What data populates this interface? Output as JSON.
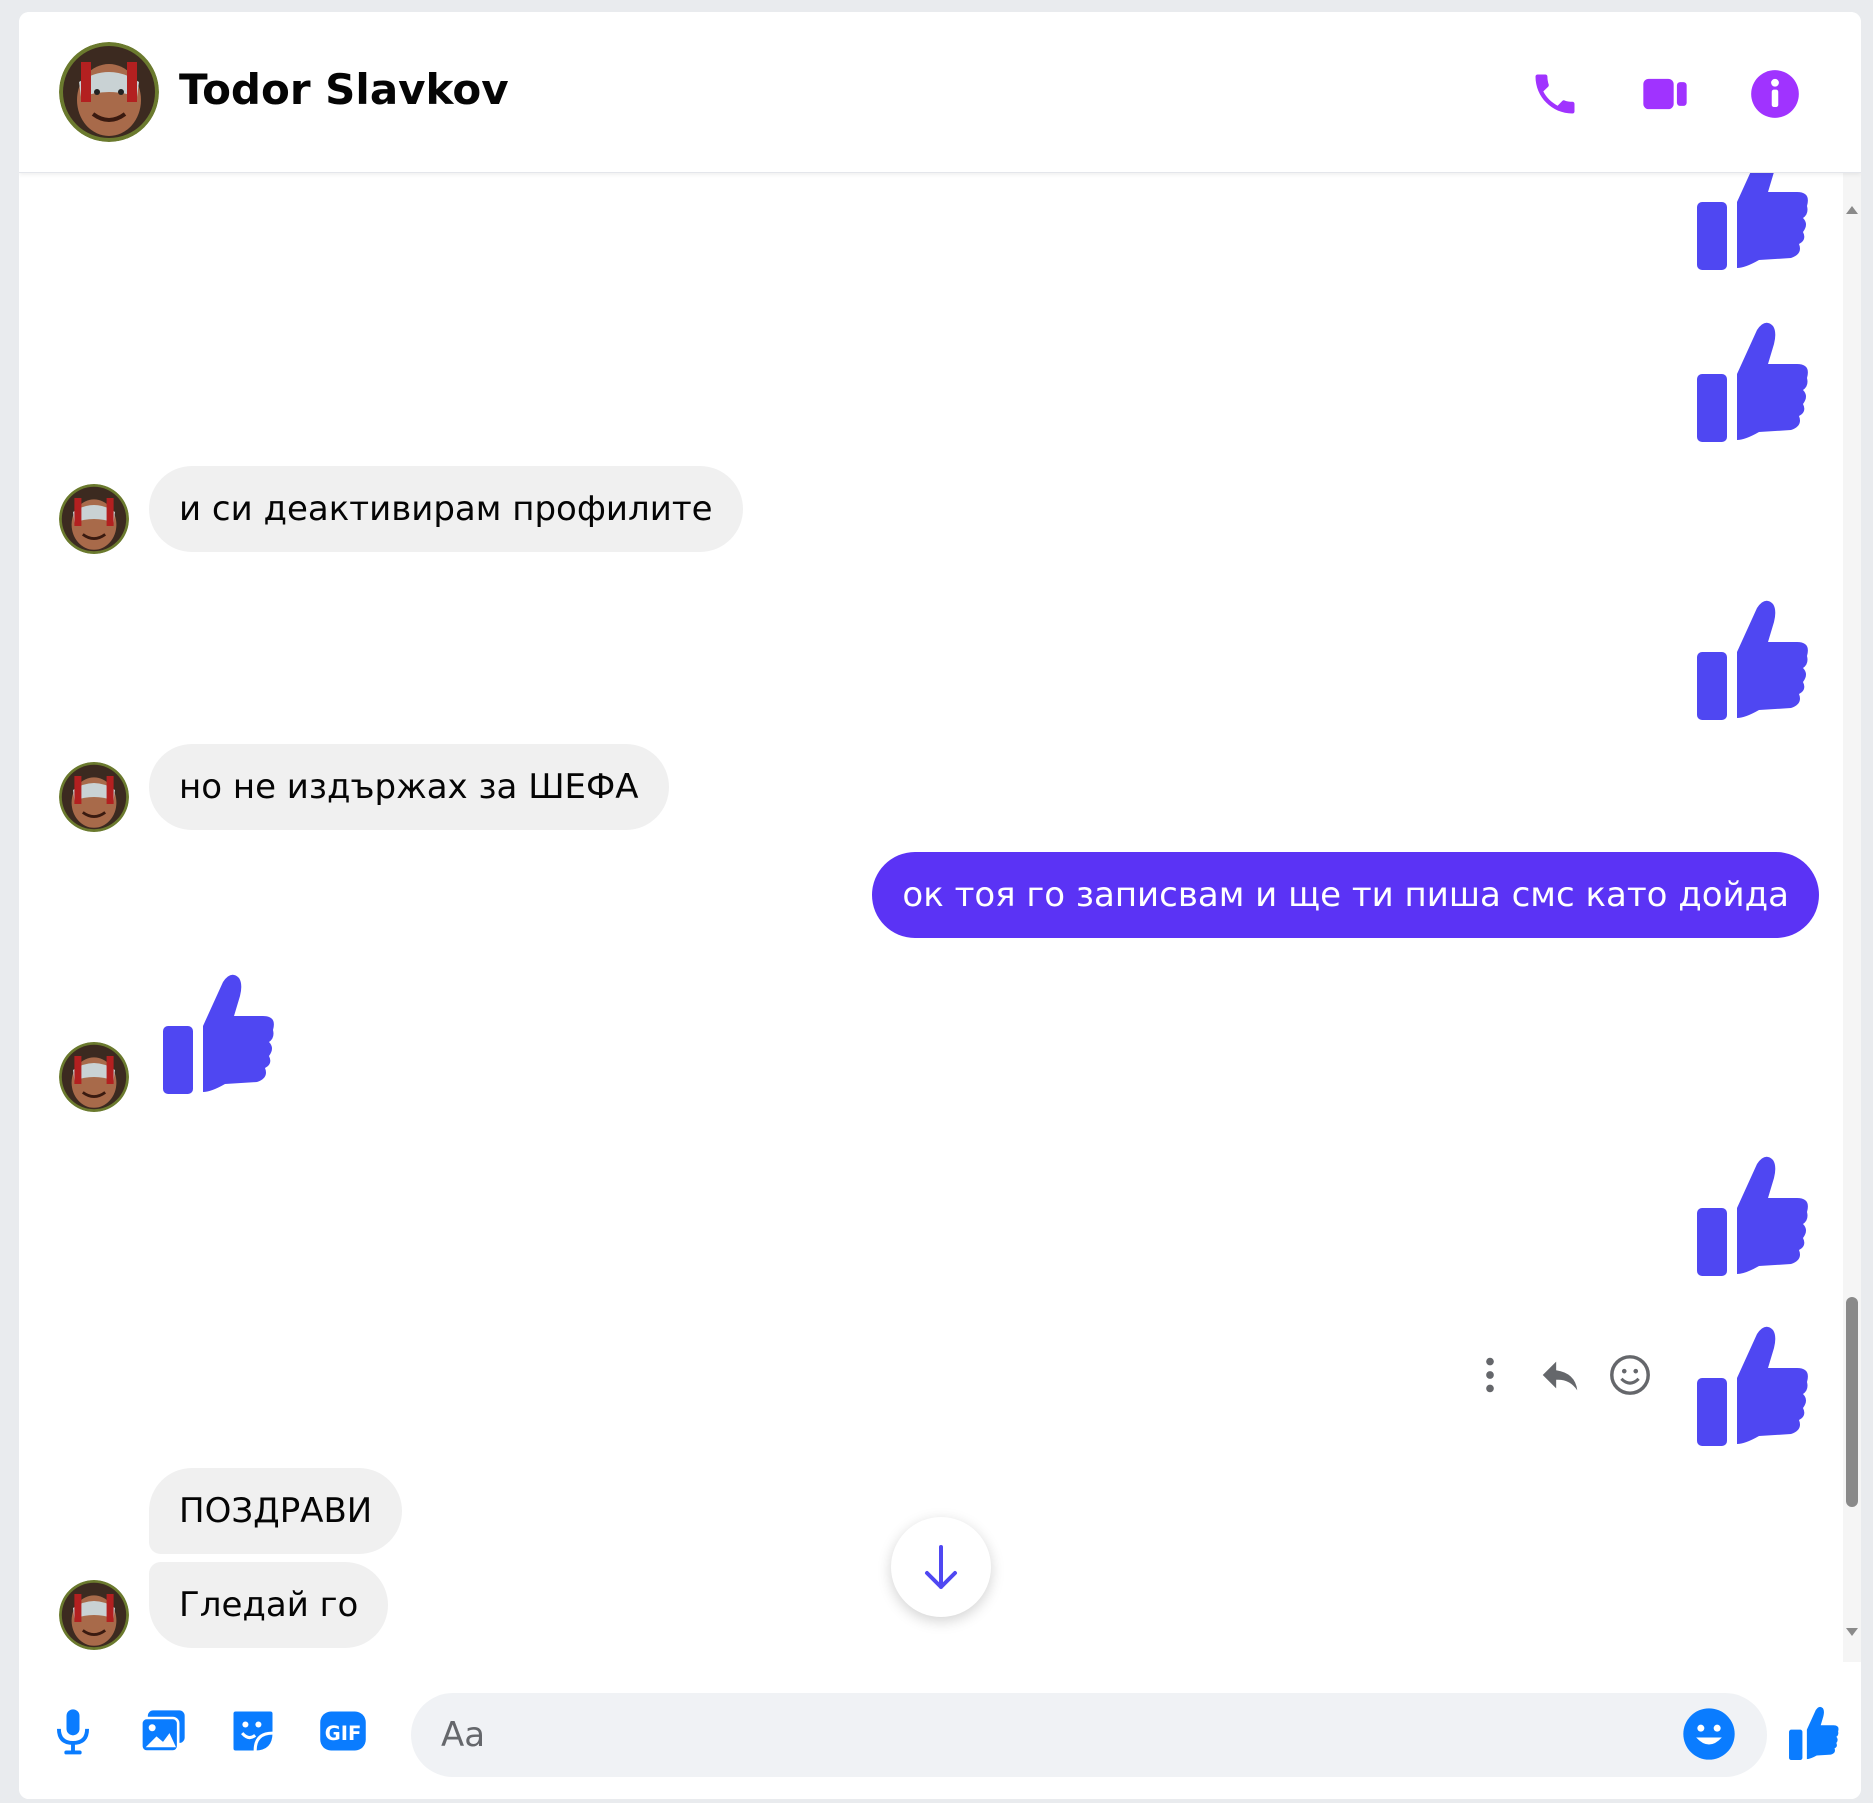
{
  "header": {
    "contact_name": "Todor Slavkov",
    "icons": [
      "phone-icon",
      "video-icon",
      "info-icon"
    ],
    "accent_color": "#a033ff"
  },
  "messages": [
    {
      "id": "m1",
      "direction": "out",
      "type": "like"
    },
    {
      "id": "m2",
      "direction": "out",
      "type": "like"
    },
    {
      "id": "m3",
      "direction": "in",
      "type": "text",
      "text": "и си деактивирам профилите"
    },
    {
      "id": "m4",
      "direction": "out",
      "type": "like"
    },
    {
      "id": "m5",
      "direction": "in",
      "type": "text",
      "text": "но не издържах за ШЕФА"
    },
    {
      "id": "m6",
      "direction": "out",
      "type": "text",
      "text": "ок тоя го записвам и ще ти пиша смс като дойда"
    },
    {
      "id": "m7",
      "direction": "in",
      "type": "like"
    },
    {
      "id": "m8",
      "direction": "out",
      "type": "like"
    },
    {
      "id": "m9",
      "direction": "out",
      "type": "like",
      "hover_actions": [
        "more-icon",
        "reply-icon",
        "react-icon"
      ]
    },
    {
      "id": "m10",
      "direction": "in",
      "type": "text",
      "text": "ПОЗДРАВИ"
    },
    {
      "id": "m11",
      "direction": "in",
      "type": "text",
      "text": "Гледай го"
    }
  ],
  "composer": {
    "placeholder": "Aa",
    "value": "",
    "icons": [
      "microphone-icon",
      "image-icon",
      "sticker-icon",
      "gif-icon",
      "emoji-icon",
      "like-icon"
    ]
  },
  "colors": {
    "outgoing_bubble": "#5b33f5",
    "incoming_bubble": "#f0f0f0",
    "like_color": "#4f47f2",
    "composer_icon": "#0a7cff"
  }
}
